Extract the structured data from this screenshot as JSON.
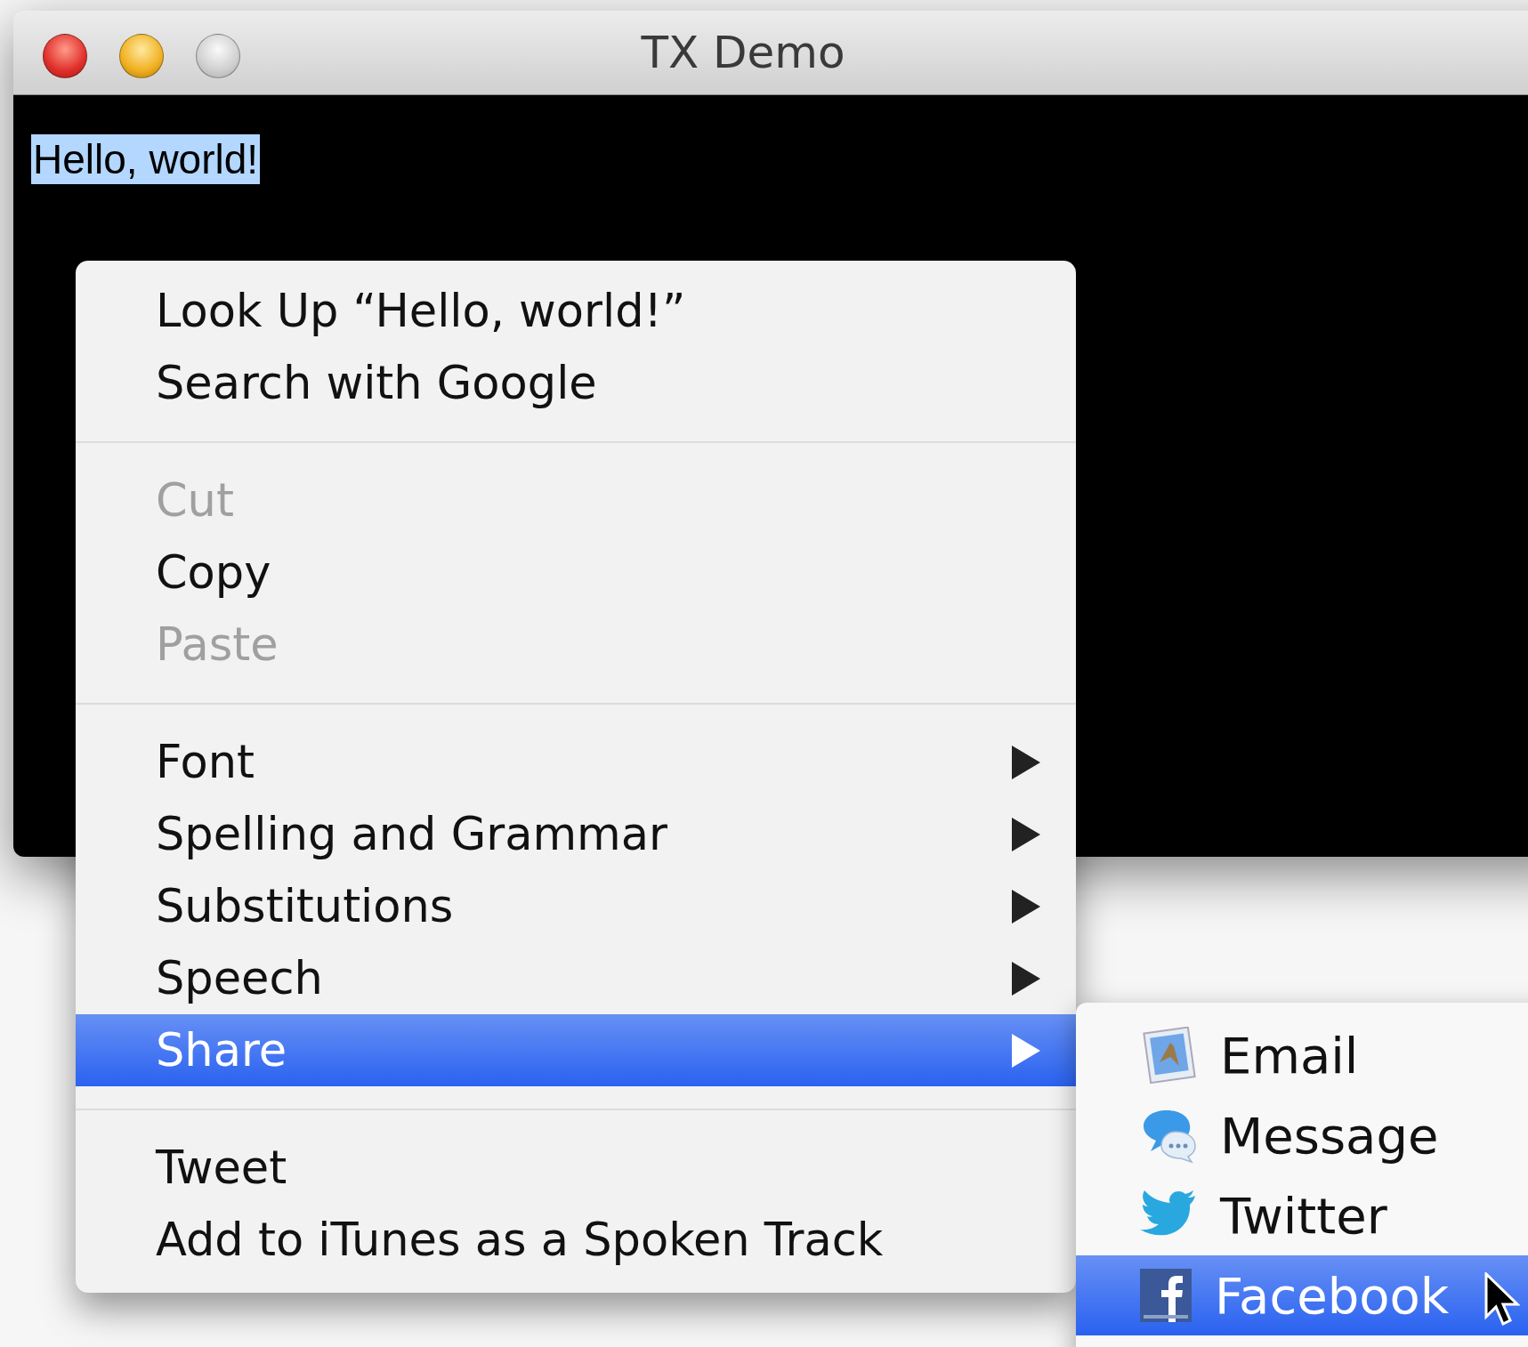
{
  "window": {
    "title": "TX Demo"
  },
  "text_view": {
    "text": "Hello, world!",
    "selected": true
  },
  "context_menu": {
    "groups": [
      {
        "items": [
          {
            "label": "Look Up “Hello, world!”",
            "disabled": false,
            "submenu": false,
            "selected": false
          },
          {
            "label": "Search with Google",
            "disabled": false,
            "submenu": false,
            "selected": false
          }
        ]
      },
      {
        "items": [
          {
            "label": "Cut",
            "disabled": true,
            "submenu": false,
            "selected": false
          },
          {
            "label": "Copy",
            "disabled": false,
            "submenu": false,
            "selected": false
          },
          {
            "label": "Paste",
            "disabled": true,
            "submenu": false,
            "selected": false
          }
        ]
      },
      {
        "items": [
          {
            "label": "Font",
            "disabled": false,
            "submenu": true,
            "selected": false
          },
          {
            "label": "Spelling and Grammar",
            "disabled": false,
            "submenu": true,
            "selected": false
          },
          {
            "label": "Substitutions",
            "disabled": false,
            "submenu": true,
            "selected": false
          },
          {
            "label": "Speech",
            "disabled": false,
            "submenu": true,
            "selected": false
          },
          {
            "label": "Share",
            "disabled": false,
            "submenu": true,
            "selected": true
          }
        ]
      },
      {
        "items": [
          {
            "label": "Tweet",
            "disabled": false,
            "submenu": false,
            "selected": false
          },
          {
            "label": "Add to iTunes as a Spoken Track",
            "disabled": false,
            "submenu": false,
            "selected": false
          }
        ]
      }
    ]
  },
  "share_submenu": {
    "items": [
      {
        "kind": "email",
        "label": "Email",
        "selected": false
      },
      {
        "kind": "message",
        "label": "Message",
        "selected": false
      },
      {
        "kind": "twitter",
        "label": "Twitter",
        "selected": false
      },
      {
        "kind": "facebook",
        "label": "Facebook",
        "selected": true
      }
    ]
  }
}
